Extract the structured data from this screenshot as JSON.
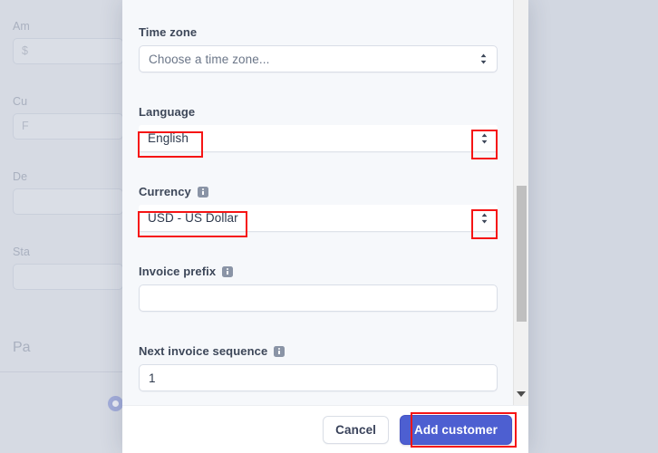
{
  "overlay": {
    "background_color": "#d2d7e1"
  },
  "background_page": {
    "fields": [
      {
        "label": "Am",
        "value": "$"
      },
      {
        "label": "Cu",
        "value": "F"
      },
      {
        "label": "De",
        "value": ""
      },
      {
        "label": "Sta",
        "value": ""
      }
    ],
    "section_heading": "Pa",
    "radio_name": "payment-option-radio"
  },
  "modal": {
    "name": "add-customer-dialog",
    "fields": {
      "time_zone": {
        "label": "Time zone",
        "value": "Choose a time zone...",
        "is_placeholder": true,
        "has_info": false,
        "chevron": "chevron-updown-icon"
      },
      "language": {
        "label": "Language",
        "value": "English",
        "is_placeholder": false,
        "has_info": false,
        "chevron": "chevron-updown-icon"
      },
      "currency": {
        "label": "Currency",
        "value": "USD - US Dollar",
        "is_placeholder": false,
        "has_info": true,
        "chevron": "chevron-updown-icon"
      },
      "invoice_prefix": {
        "label": "Invoice prefix",
        "value": "",
        "placeholder": "",
        "has_info": true
      },
      "next_invoice_sequence": {
        "label": "Next invoice sequence",
        "value": "1",
        "has_info": true
      }
    },
    "scrollbar": {
      "name": "modal-scrollbar",
      "down_arrow": "triangle-down-icon"
    },
    "footer": {
      "cancel_label": "Cancel",
      "submit_label": "Add customer",
      "primary_color": "#4d5fd1"
    }
  },
  "annotations": {
    "highlight_color": "#f61515",
    "boxes": [
      {
        "name": "highlight-language-value"
      },
      {
        "name": "highlight-language-chevron"
      },
      {
        "name": "highlight-currency-value"
      },
      {
        "name": "highlight-currency-chevron"
      },
      {
        "name": "highlight-add-customer-button"
      }
    ]
  }
}
